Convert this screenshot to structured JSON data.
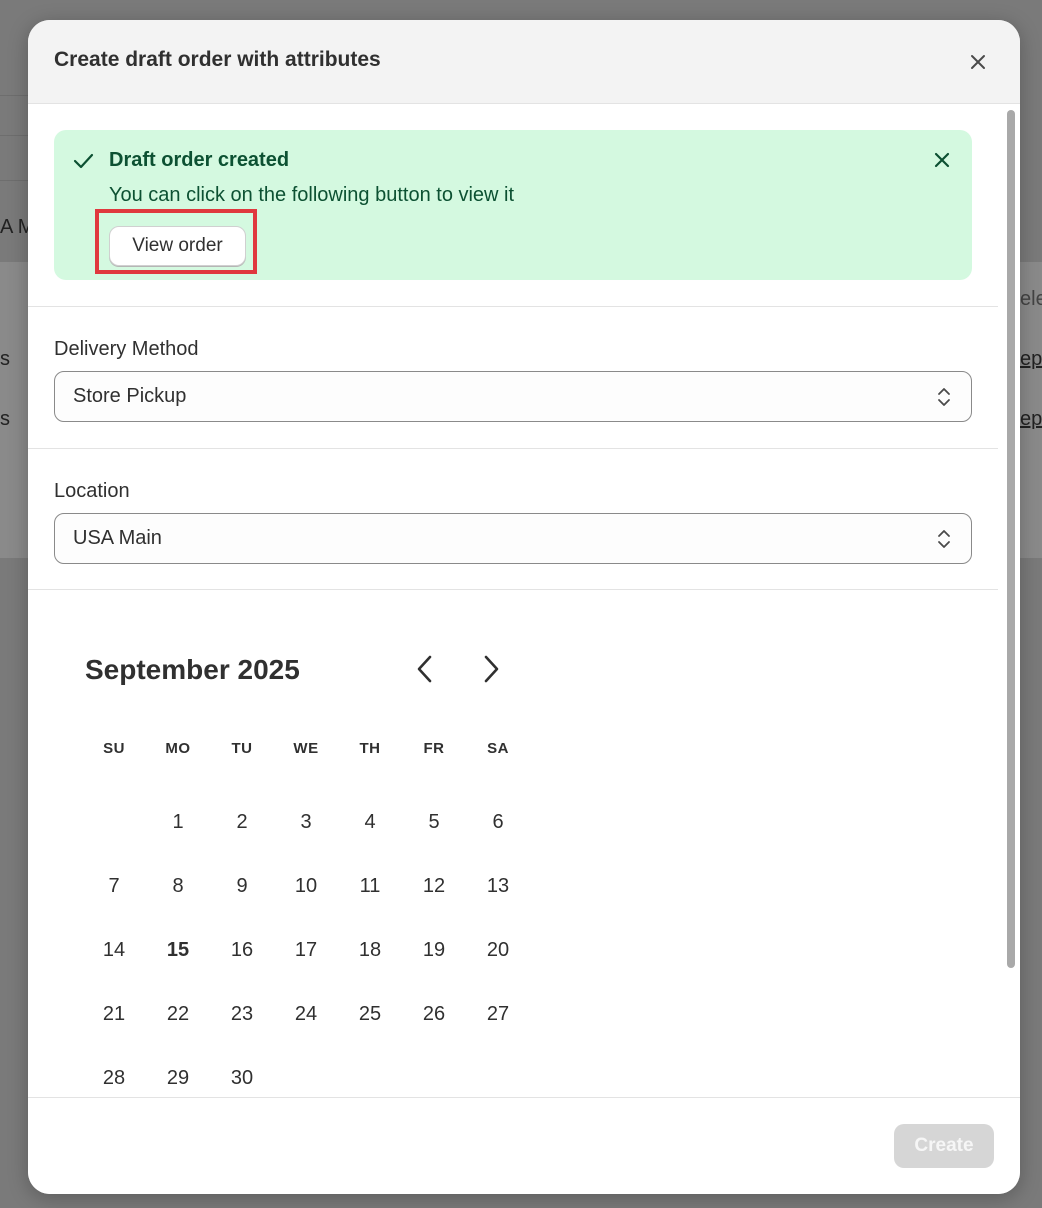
{
  "background": {
    "left_fragments": [
      "A M",
      "s",
      "s"
    ],
    "right_fragments": [
      "ele",
      "ep",
      "ep"
    ]
  },
  "modal": {
    "title": "Create draft order with attributes",
    "close_icon": "close-icon"
  },
  "banner": {
    "title": "Draft order created",
    "message": "You can click on the following button to view it",
    "button_label": "View order",
    "background_color": "#d4f9e0",
    "text_color": "#0c5132",
    "highlight_color": "#e0383e"
  },
  "delivery": {
    "label": "Delivery Method",
    "value": "Store Pickup"
  },
  "location": {
    "label": "Location",
    "value": "USA Main"
  },
  "calendar": {
    "month_label": "September 2025",
    "weekdays": [
      "SU",
      "MO",
      "TU",
      "WE",
      "TH",
      "FR",
      "SA"
    ],
    "leading_blanks": 1,
    "days_in_month": 30,
    "today": 15
  },
  "footer": {
    "create_label": "Create"
  }
}
